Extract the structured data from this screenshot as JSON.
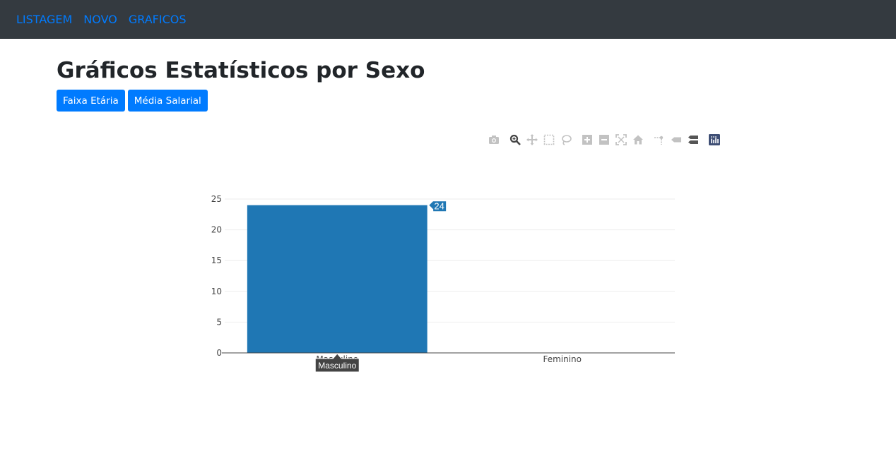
{
  "nav": {
    "items": [
      {
        "label": "LISTAGEM"
      },
      {
        "label": "NOVO"
      },
      {
        "label": "GRAFICOS"
      }
    ]
  },
  "page": {
    "title": "Gráficos Estatísticos por Sexo"
  },
  "buttons": {
    "faixa_etaria": "Faixa Etária",
    "media_salarial": "Média Salarial"
  },
  "modebar": {
    "icons": [
      "camera-icon",
      "zoom-icon",
      "pan-icon",
      "box-select-icon",
      "lasso-icon",
      "zoom-in-icon",
      "zoom-out-icon",
      "autoscale-icon",
      "home-icon",
      "spike-lines-icon",
      "hover-closest-icon",
      "hover-compare-icon",
      "plotly-logo-icon"
    ]
  },
  "colors": {
    "navbar_bg": "#343a40",
    "link": "#007bff",
    "button": "#007bff",
    "bar": "#1f77b4"
  },
  "chart_data": {
    "type": "bar",
    "categories": [
      "Masculino",
      "Feminino"
    ],
    "values": [
      24,
      0
    ],
    "ylim": [
      0,
      25
    ],
    "yticks": [
      0,
      5,
      10,
      15,
      20,
      25
    ],
    "grid": true,
    "hover": {
      "value_label": "24",
      "category_label": "Masculino"
    }
  }
}
